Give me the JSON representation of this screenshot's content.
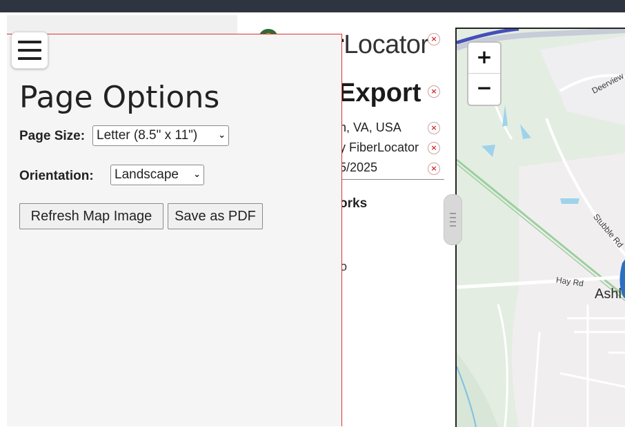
{
  "header": {
    "logo_bold": "r",
    "logo_light": "Locator"
  },
  "export": {
    "title": "Export",
    "meta": [
      "n, VA, USA",
      "y FiberLocator",
      "5/2025"
    ],
    "works_heading": "orks",
    "fragment": "o"
  },
  "panel": {
    "title": "Page Options",
    "page_size_label": "Page Size:",
    "page_size_value": "Letter (8.5\" x 11\")",
    "orientation_label": "Orientation:",
    "orientation_value": "Landscape",
    "refresh_label": "Refresh Map Image",
    "save_label": "Save as PDF"
  },
  "map": {
    "zoom_in": "+",
    "zoom_out": "−",
    "labels": {
      "deerview": "Deerview",
      "stubble": "Stubble Rd",
      "hay": "Hay Rd",
      "ash": "Ashl"
    }
  },
  "icons": {
    "remove": "×",
    "chevron": "⌄"
  },
  "colors": {
    "topbar": "#2e3540",
    "panel_border": "#e03030",
    "remove_icon": "#d12b2b",
    "map_marker": "#2a6fc0"
  }
}
